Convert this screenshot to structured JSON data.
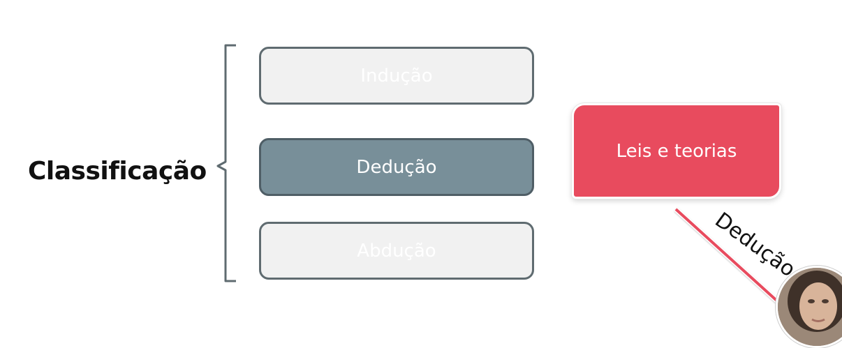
{
  "heading": "Classificação",
  "options": {
    "induction": "Indução",
    "deduction": "Dedução",
    "abduction": "Abdução"
  },
  "laws_box": "Leis e teorias",
  "arrow_label": "Dedução",
  "colors": {
    "active_box": "#788f99",
    "inactive_box": "#f1f1f1",
    "box_border": "#5f6b70",
    "laws_box": "#e84b5e",
    "arrow": "#e84b5e"
  }
}
